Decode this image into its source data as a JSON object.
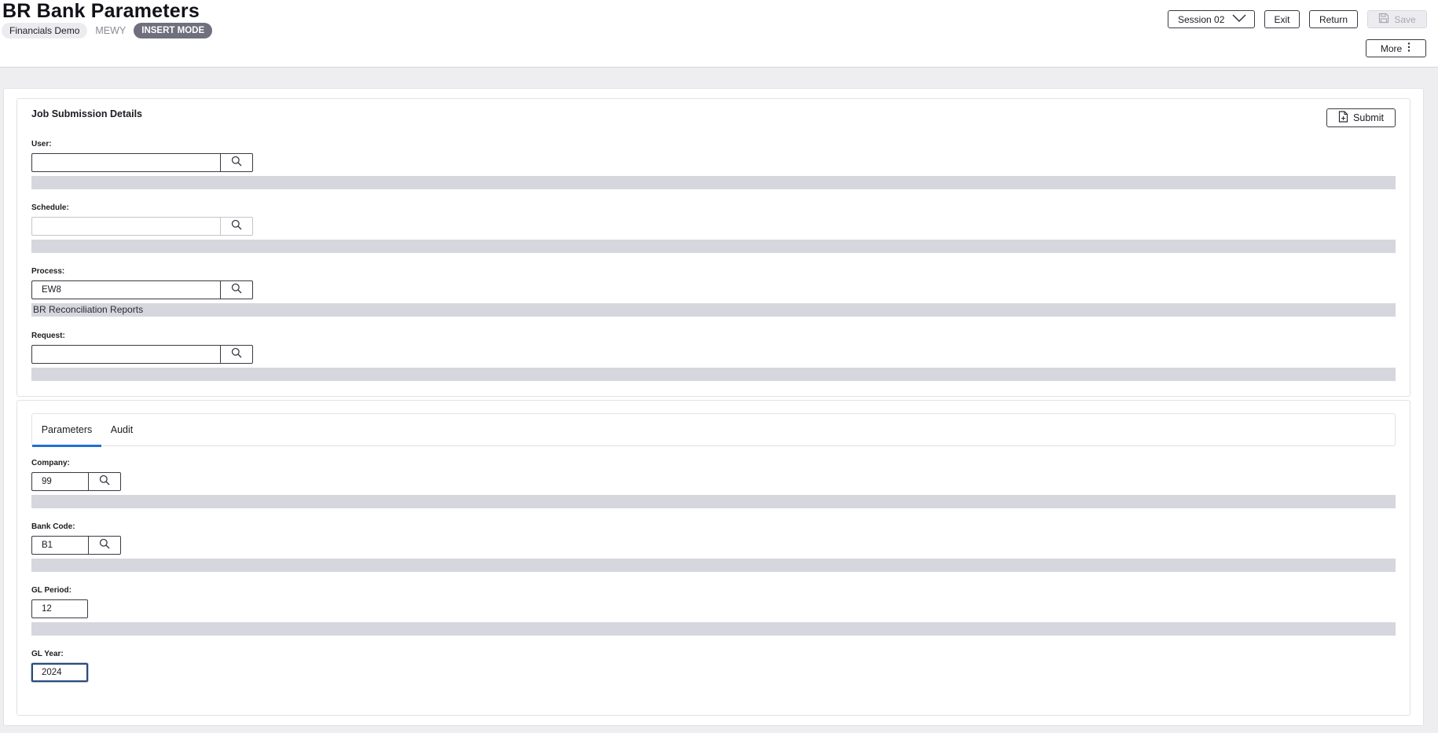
{
  "header": {
    "title": "BR Bank Parameters",
    "environment": "Financials Demo",
    "program_code": "MEWY",
    "mode": "INSERT MODE",
    "session_label": "Session 02",
    "exit_label": "Exit",
    "return_label": "Return",
    "save_label": "Save",
    "more_label": "More"
  },
  "job_submission": {
    "title": "Job Submission Details",
    "submit_label": "Submit",
    "fields": {
      "user": {
        "label": "User:",
        "value": "",
        "description": ""
      },
      "schedule": {
        "label": "Schedule:",
        "value": "",
        "description": "",
        "disabled": true
      },
      "process": {
        "label": "Process:",
        "value": "EW8",
        "description": "BR Reconciliation Reports"
      },
      "request": {
        "label": "Request:",
        "value": "",
        "description": ""
      }
    }
  },
  "tabs": {
    "parameters": "Parameters",
    "audit": "Audit",
    "active": "Parameters"
  },
  "parameters": {
    "company": {
      "label": "Company:",
      "value": "99",
      "description": ""
    },
    "bank_code": {
      "label": "Bank Code:",
      "value": "B1",
      "description": ""
    },
    "gl_period": {
      "label": "GL Period:",
      "value": "12",
      "description": ""
    },
    "gl_year": {
      "label": "GL Year:",
      "value": "2024",
      "focused": true
    }
  },
  "colors": {
    "accent": "#1f6fd1",
    "mode_badge": "#6f6f7e",
    "description_bar": "#d6d6df"
  },
  "icons": {
    "lookup": "search-icon",
    "submit": "document-icon",
    "save": "floppy-disk-icon",
    "more": "vertical-ellipsis-icon",
    "session": "chevron-down-icon"
  }
}
